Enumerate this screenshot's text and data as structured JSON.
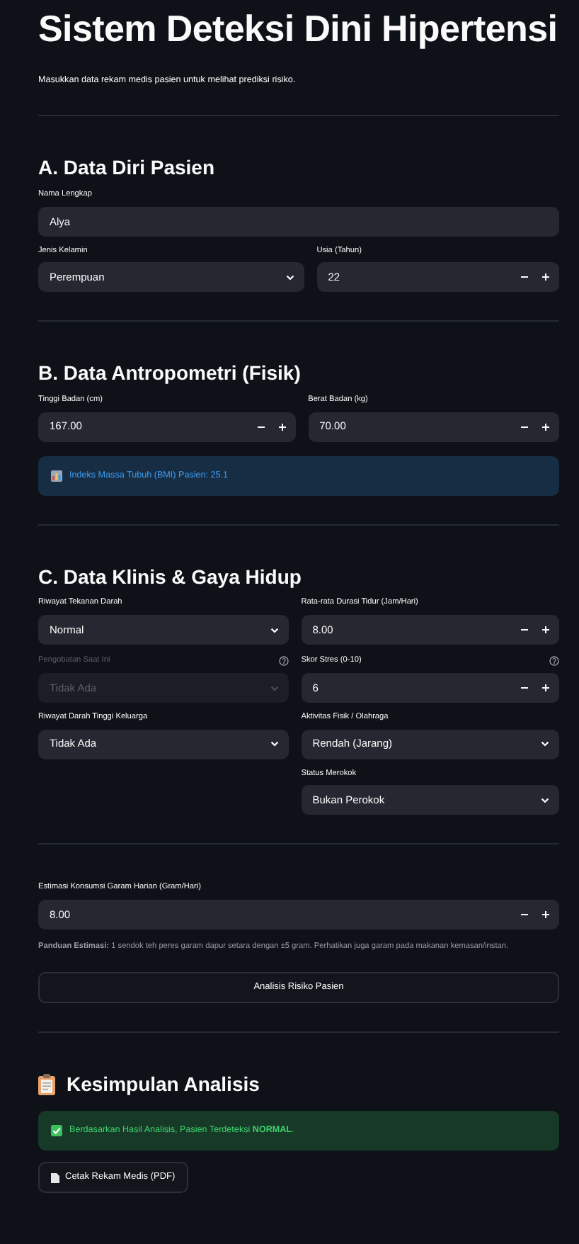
{
  "title": "Sistem Deteksi Dini Hipertensi",
  "subtitle": "Masukkan data rekam medis pasien untuk melihat prediksi risiko.",
  "sections": [
    {
      "heading": "A. Data Diri Pasien",
      "rows": [
        [
          {
            "kind": "text",
            "label": "Nama Lengkap",
            "value": "Alya",
            "disabled": false,
            "help": false
          }
        ],
        [
          {
            "kind": "select",
            "label": "Jenis Kelamin",
            "value": "Perempuan",
            "disabled": false,
            "help": false
          },
          {
            "kind": "number",
            "label": "Usia (Tahun)",
            "value": "22",
            "disabled": false,
            "help": false
          }
        ]
      ]
    },
    {
      "heading": "B. Data Antropometri (Fisik)",
      "rows": [
        [
          {
            "kind": "number",
            "label": "Tinggi Badan (cm)",
            "value": "167.00",
            "disabled": false,
            "help": false
          },
          {
            "kind": "number",
            "label": "Berat Badan (kg)",
            "value": "70.00",
            "disabled": false,
            "help": false
          }
        ]
      ],
      "alert": {
        "kind": "info",
        "text": "Indeks Massa Tubuh (BMI) Pasien: 25.1"
      }
    },
    {
      "heading": "C. Data Klinis & Gaya Hidup",
      "columns": [
        [
          {
            "kind": "select",
            "label": "Riwayat Tekanan Darah",
            "value": "Normal",
            "disabled": false,
            "help": false
          },
          {
            "kind": "select",
            "label": "Pengobatan Saat Ini",
            "value": "Tidak Ada",
            "disabled": true,
            "help": true
          },
          {
            "kind": "select",
            "label": "Riwayat Darah Tinggi Keluarga",
            "value": "Tidak Ada",
            "disabled": false,
            "help": false
          }
        ],
        [
          {
            "kind": "number",
            "label": "Rata-rata Durasi Tidur (Jam/Hari)",
            "value": "8.00",
            "disabled": false,
            "help": false
          },
          {
            "kind": "number",
            "label": "Skor Stres (0-10)",
            "value": "6",
            "disabled": false,
            "help": true
          },
          {
            "kind": "select",
            "label": "Aktivitas Fisik / Olahraga",
            "value": "Rendah (Jarang)",
            "disabled": false,
            "help": false
          },
          {
            "kind": "select",
            "label": "Status Merokok",
            "value": "Bukan Perokok",
            "disabled": false,
            "help": false
          }
        ]
      ]
    },
    {
      "rows": [
        [
          {
            "kind": "number",
            "label": "Estimasi Konsumsi Garam Harian (Gram/Hari)",
            "value": "8.00",
            "disabled": false,
            "help": false
          }
        ]
      ],
      "note": "**Panduan Estimasi:** 1 sendok teh peres garam dapur setara dengan ±5 gram. Perhatikan juga garam pada makanan kemasan/instan.",
      "button": "Analisis Risiko Pasien"
    },
    {
      "kind": "result",
      "heading": "Kesimpulan Analisis",
      "alert": {
        "kind": "success",
        "text": "Berdasarkan Hasil Analisis, Pasien Terdeteksi **NORMAL**."
      },
      "download": "Cetak Rekam Medis (PDF)"
    }
  ]
}
